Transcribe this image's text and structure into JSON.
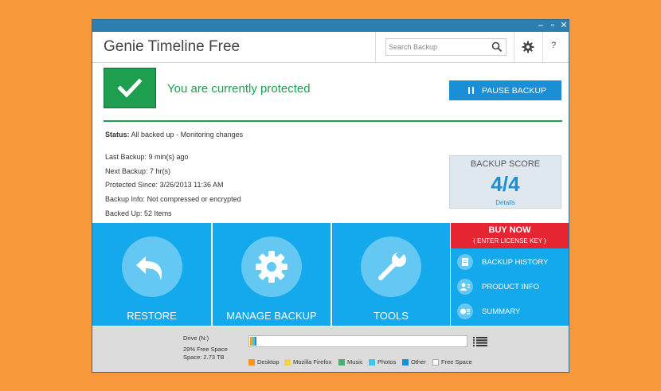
{
  "window": {
    "controls": {
      "minimize": "–",
      "maximize": "▫",
      "close": "✕"
    }
  },
  "header": {
    "title": "Genie Timeline Free",
    "search_placeholder": "Search Backup",
    "help_label": "?"
  },
  "protection": {
    "message": "You are currently protected",
    "pause_label": "PAUSE BACKUP"
  },
  "status": {
    "label": "Status:",
    "value": "All backed up - Monitoring changes"
  },
  "info": [
    {
      "label": "Last Backup:",
      "value": "9 min(s) ago"
    },
    {
      "label": "Next Backup:",
      "value": "7 hr(s)"
    },
    {
      "label": "Protected Since:",
      "value": "3/26/2013 11:36 AM"
    },
    {
      "label": "Backup Info:",
      "value": "Not compressed or encrypted"
    },
    {
      "label": "Backed Up:",
      "value": "52 Items"
    }
  ],
  "score": {
    "title": "BACKUP SCORE",
    "value": "4/4",
    "details_label": "Details"
  },
  "tiles": [
    {
      "label": "RESTORE"
    },
    {
      "label": "MANAGE BACKUP"
    },
    {
      "label": "TOOLS"
    }
  ],
  "buy": {
    "title": "BUY NOW",
    "subtitle": "( ENTER LICENSE KEY )"
  },
  "side_menu": [
    {
      "label": "BACKUP HISTORY"
    },
    {
      "label": "PRODUCT INFO"
    },
    {
      "label": "SUMMARY"
    }
  ],
  "drive": {
    "name": "Drive (N:)",
    "free_space": "29% Free Space",
    "capacity": "Space: 2.73 TB",
    "usage_fractions": [
      0.008,
      0.004,
      0.004,
      0.008,
      0.008
    ],
    "legend": [
      {
        "label": "Desktop",
        "color": "#F7941D"
      },
      {
        "label": "Mozilla Firefox",
        "color": "#F4D250"
      },
      {
        "label": "Music",
        "color": "#4CAF70"
      },
      {
        "label": "Photos",
        "color": "#3FC7E8"
      },
      {
        "label": "Other",
        "color": "#1A8FD6"
      },
      {
        "label": "Free Space",
        "color": "#FFFFFF"
      }
    ]
  },
  "colors": {
    "background": "#F7983A",
    "accent_blue": "#13A9EC",
    "protected_green": "#1E9E4F",
    "buy_red": "#E52532"
  }
}
